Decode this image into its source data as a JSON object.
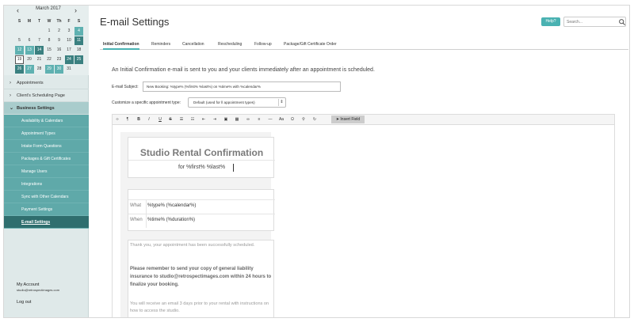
{
  "calendar": {
    "month_label": "March 2017",
    "prev": "‹",
    "next": "›",
    "weekdays": [
      "S",
      "M",
      "T",
      "W",
      "Th",
      "F",
      "S"
    ],
    "weeks": [
      [
        "",
        "",
        "",
        "1",
        "2",
        "3",
        "4"
      ],
      [
        "5",
        "6",
        "7",
        "8",
        "9",
        "10",
        "11"
      ],
      [
        "12",
        "13",
        "14",
        "15",
        "16",
        "17",
        "18"
      ],
      [
        "19",
        "20",
        "21",
        "22",
        "23",
        "24",
        "25"
      ],
      [
        "26",
        "27",
        "28",
        "29",
        "30",
        "31",
        ""
      ]
    ]
  },
  "sidebar": {
    "appointments": "Appointments",
    "client_page": "Client's Scheduling Page",
    "business_settings": "Business Settings",
    "sub_items": [
      "Availability & Calendars",
      "Appointment Types",
      "Intake Form Questions",
      "Packages & Gift Certificates",
      "Manage Users",
      "Integrations",
      "Sync with Other Calendars",
      "Payment Settings",
      "E-mail Settings"
    ],
    "account_title": "My Account",
    "account_email": "studio@retrospectimages.com",
    "logout": "Log out"
  },
  "header": {
    "title": "E-mail Settings",
    "help": "Help?",
    "search_placeholder": "Search..."
  },
  "tabs": [
    "Initial Confirmation",
    "Reminders",
    "Cancellation",
    "Rescheduling",
    "Follow-up",
    "Package/Gift Certificate Order"
  ],
  "form": {
    "intro": "An Initial Confirmation e-mail is sent to you and your clients immediately after an appointment is scheduled.",
    "subject_label": "E-mail Subject:",
    "subject_value": "New Booking: %type% (%first% %last%) on %time% with %calendar%",
    "customize_label": "Customize a specific appointment type:",
    "customize_value": "Default (used for ll appointment types)"
  },
  "toolbar": {
    "buttons": [
      "‹›",
      "¶",
      "B",
      "I",
      "U",
      "S",
      "☰",
      "☷",
      "⇤",
      "⇥",
      "▣",
      "▦",
      "∞",
      "≡",
      "—",
      "Aa",
      "Ω",
      "⚲",
      "↻"
    ],
    "insert_field": "Insert Field"
  },
  "template": {
    "title": "Studio Rental Confirmation",
    "subtitle": "for %first% %last%",
    "what_label": "What",
    "what_value": "%type% (%calendar%)",
    "when_label": "When",
    "when_value": "%time% (%duration%)",
    "thanks": "Thank you, your appointment has been successfully scheduled.",
    "reminder": "Please remember to send your copy of general liability insurance to studio@retrospectimages.com within 24 hours to finalize your booking.",
    "email_note": "You will receive an email 3 days prior to your rental with instructions on how to access the studio."
  }
}
